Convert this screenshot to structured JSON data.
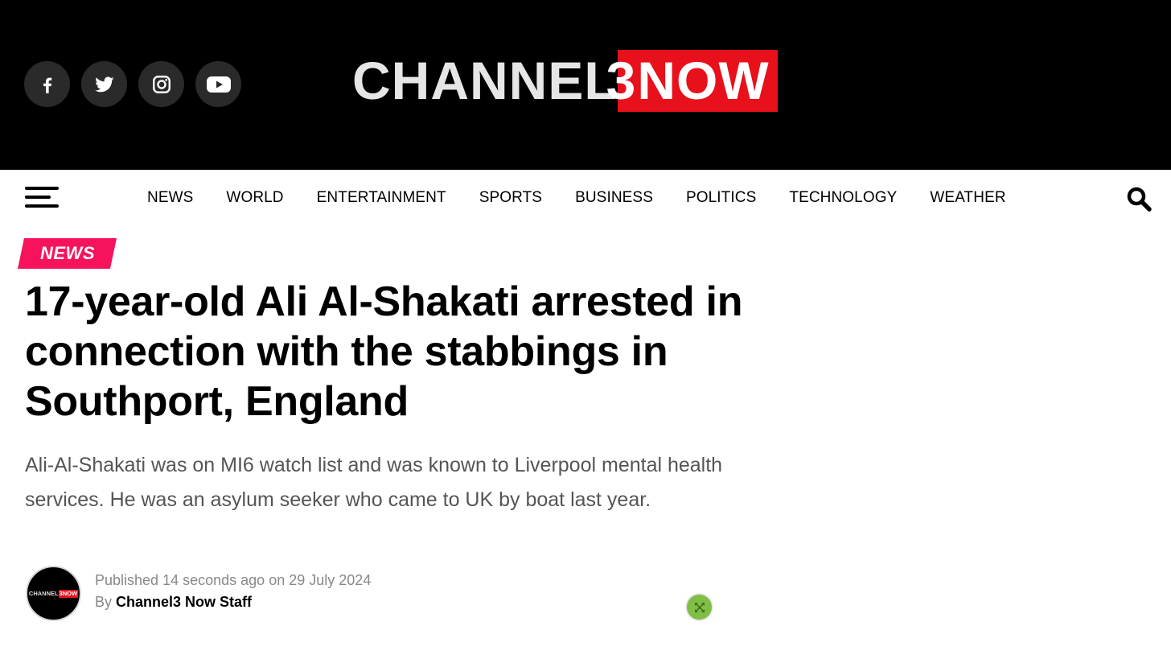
{
  "header": {
    "logo": {
      "part1": "CHANNEL",
      "part2": "3",
      "part3": "NOW"
    },
    "social": [
      {
        "name": "facebook-icon"
      },
      {
        "name": "twitter-icon"
      },
      {
        "name": "instagram-icon"
      },
      {
        "name": "youtube-icon"
      }
    ]
  },
  "nav": {
    "items": [
      "NEWS",
      "WORLD",
      "ENTERTAINMENT",
      "SPORTS",
      "BUSINESS",
      "POLITICS",
      "TECHNOLOGY",
      "WEATHER"
    ]
  },
  "article": {
    "category": "NEWS",
    "headline": "17-year-old Ali Al-Shakati arrested in connection with the stabbings in Southport, England",
    "excerpt": "Ali-Al-Shakati was on MI6 watch list and was known to Liverpool mental health services. He was an asylum seeker who came to UK by boat last year.",
    "published_prefix": "Published",
    "published_ago": "14 seconds ago",
    "published_on": "on",
    "published_date": "29 July 2024",
    "by_label": "By",
    "author": "Channel3 Now Staff",
    "avatar_logo": {
      "white": "CHANNEL",
      "red": "3NOW"
    }
  },
  "colors": {
    "header_bg": "#000000",
    "logo_red": "#e8101b",
    "category_pink": "#f6135c",
    "float_button_green": "#7fbf45"
  }
}
